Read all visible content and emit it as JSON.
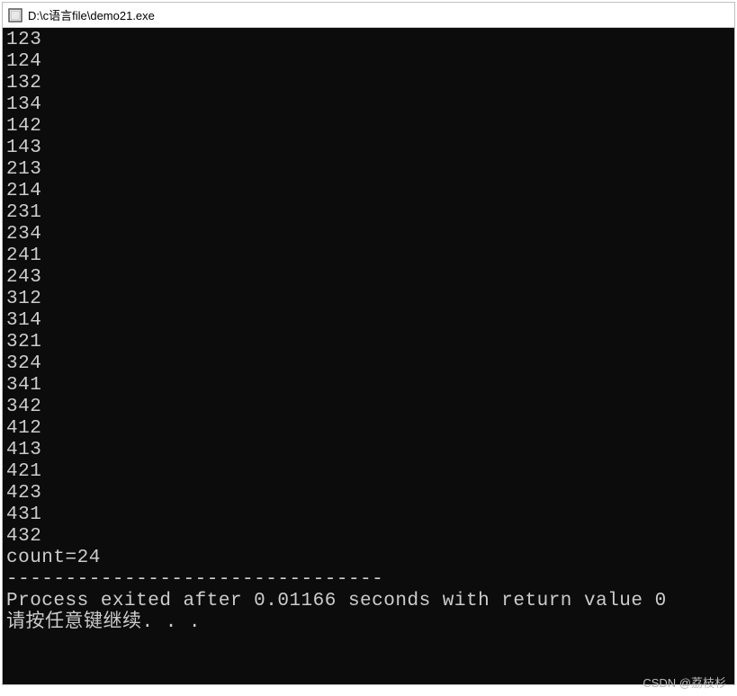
{
  "titlebar": {
    "title": "D:\\c语言file\\demo21.exe"
  },
  "console": {
    "lines": [
      "123",
      "124",
      "132",
      "134",
      "142",
      "143",
      "213",
      "214",
      "231",
      "234",
      "241",
      "243",
      "312",
      "314",
      "321",
      "324",
      "341",
      "342",
      "412",
      "413",
      "421",
      "423",
      "431",
      "432",
      "count=24",
      "--------------------------------",
      "Process exited after 0.01166 seconds with return value 0",
      "请按任意键继续. . ."
    ]
  },
  "watermark": {
    "text": "CSDN @荔枝杉"
  }
}
